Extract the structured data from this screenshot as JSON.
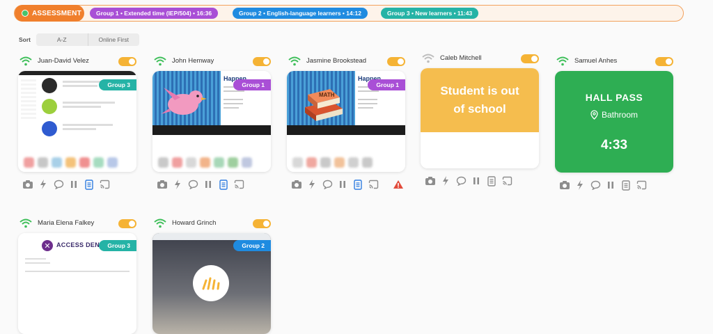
{
  "banner": {
    "label": "ASSESSMENT",
    "groups": [
      {
        "text": "Group 1 • Extended time (IEP/504) • 16:36",
        "color": "#a94fd6"
      },
      {
        "text": "Group 2 • English-language learners • 14:12",
        "color": "#1f8be0"
      },
      {
        "text": "Group 3 • New learners • 11:43",
        "color": "#25b3a6"
      }
    ]
  },
  "sort": {
    "label": "Sort",
    "options": [
      "A-Z",
      "Online First"
    ]
  },
  "colors": {
    "group1": "#a94fd6",
    "group2": "#1f8be0",
    "group3": "#25b3a6",
    "wifi": "#3fbf5a",
    "toggle": "#f5b335",
    "warning": "#e24b3b"
  },
  "students": [
    {
      "name": "Juan-David Velez",
      "group": "Group 3"
    },
    {
      "name": "John Hemway",
      "group": "Group 1",
      "page_title": "Happen"
    },
    {
      "name": "Jasmine Brookstead",
      "group": "Group 1",
      "page_title": "Happen",
      "book_label": "MATH"
    },
    {
      "name": "Caleb Mitchell",
      "status": "Student is out of school"
    },
    {
      "name": "Samuel Anhes",
      "hall_pass": "HALL PASS",
      "location": "Bathroom",
      "timer": "4:33"
    },
    {
      "name": "Maria Elena Falkey",
      "group": "Group 3",
      "denied": "ACCESS DENIED"
    },
    {
      "name": "Howard Grinch",
      "group": "Group 2"
    }
  ]
}
